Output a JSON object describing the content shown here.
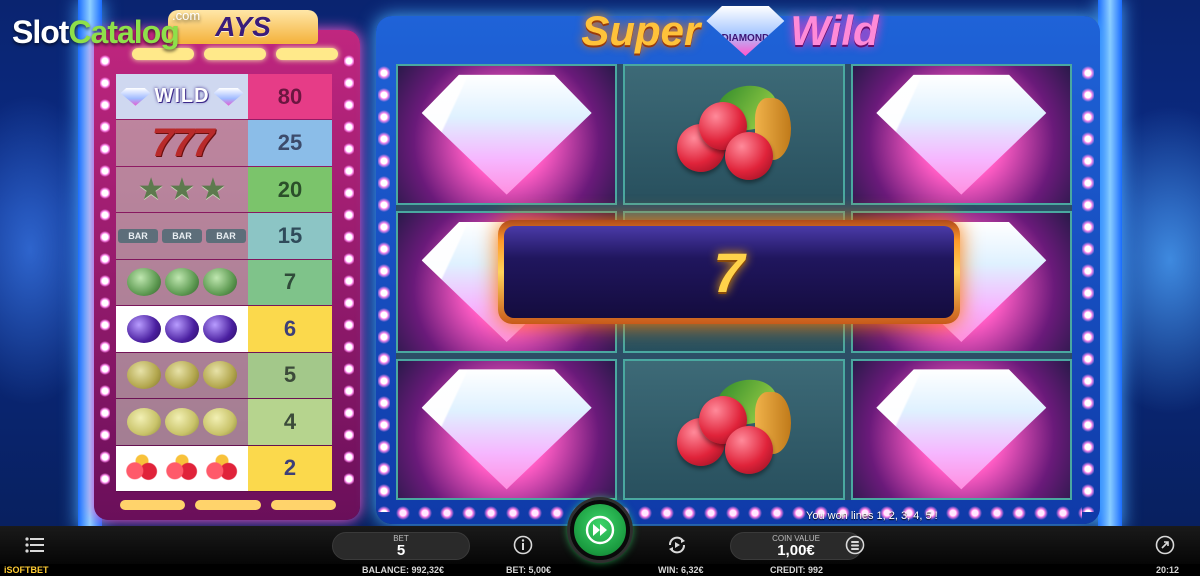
{
  "watermark": {
    "slot": "Slot",
    "catalog": "Catalog",
    "com": ".com"
  },
  "game": {
    "title_left": "Super",
    "title_gem_label": "DIAMOND",
    "title_right": "Wild",
    "paytable_title": "AYS"
  },
  "paytable": {
    "rows": [
      {
        "symbol": "wild",
        "wild_label": "WILD",
        "payout": "80",
        "highlighted": false
      },
      {
        "symbol": "seven",
        "seven_label": "777",
        "payout": "25",
        "highlighted": false
      },
      {
        "symbol": "star",
        "payout": "20",
        "highlighted": false
      },
      {
        "symbol": "bar",
        "bar_label": "BAR",
        "payout": "15",
        "highlighted": false
      },
      {
        "symbol": "melon",
        "payout": "7",
        "highlighted": false
      },
      {
        "symbol": "plum",
        "payout": "6",
        "highlighted": true
      },
      {
        "symbol": "orange",
        "payout": "5",
        "highlighted": false
      },
      {
        "symbol": "lemon",
        "payout": "4",
        "highlighted": false
      },
      {
        "symbol": "cherry",
        "payout": "2",
        "highlighted": true
      }
    ]
  },
  "reels": [
    [
      "diamond",
      "cherry",
      "diamond"
    ],
    [
      "diamond",
      "seven",
      "diamond"
    ],
    [
      "diamond",
      "cherry",
      "diamond"
    ]
  ],
  "win_banner": {
    "amount": "7"
  },
  "win_lines_message": "You won lines 1, 2, 3, 4, 5 !",
  "controls": {
    "bet_label": "BET",
    "bet_value": "5",
    "coin_value_label": "COIN VALUE",
    "coin_value": "1,00€",
    "icons": {
      "menu": "menu-icon",
      "info": "info-icon",
      "spin": "spin-fast-forward-icon",
      "autoplay": "autoplay-icon",
      "coins": "coins-icon",
      "expand": "expand-icon"
    }
  },
  "status": {
    "brand": "iSOFTBET",
    "balance": "BALANCE: 992,32€",
    "bet": "BET: 5,00€",
    "win": "WIN: 6,32€",
    "credit": "CREDIT: 992",
    "time": "20:12"
  },
  "colors": {
    "accent_pink": "#ff5ad0",
    "frame_blue": "#1f63d8",
    "win_gold": "#ffd24a",
    "spin_green": "#1a9a3f"
  }
}
